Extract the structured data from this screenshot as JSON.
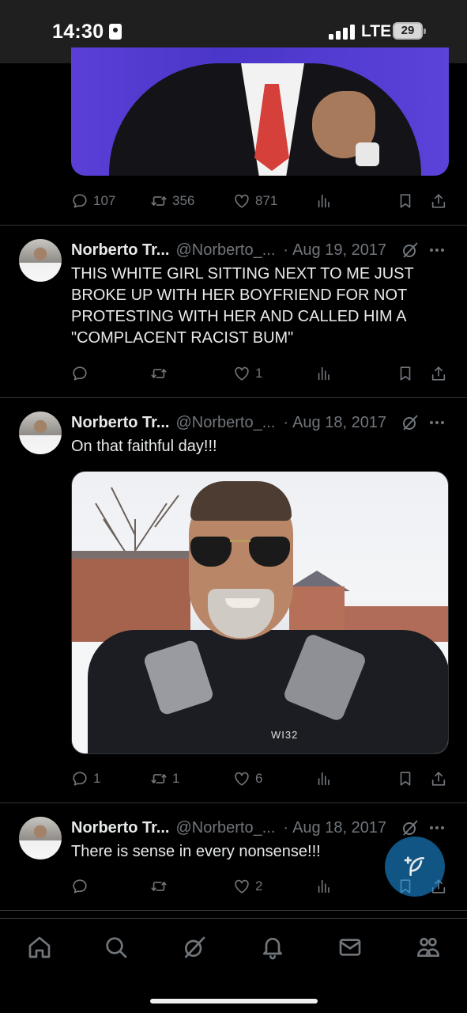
{
  "status_bar": {
    "time": "14:30",
    "network": "LTE",
    "battery": "29"
  },
  "tweets": [
    {
      "counts": {
        "reply": "107",
        "retweet": "356",
        "like": "871"
      }
    },
    {
      "name": "Norberto Tr...",
      "handle": "@Norberto_...",
      "dot": "·",
      "date": "Aug 19, 2017",
      "text": "THIS WHITE GIRL SITTING NEXT TO ME JUST BROKE UP WITH HER BOYFRIEND FOR NOT PROTESTING WITH HER AND CALLED HIM A \"COMPLACENT RACIST BUM\"",
      "counts": {
        "reply": "",
        "retweet": "",
        "like": "1"
      }
    },
    {
      "name": "Norberto Tr...",
      "handle": "@Norberto_...",
      "dot": "·",
      "date": "Aug 18, 2017",
      "text": "On that faithful day!!!",
      "photo_brand": "WI32",
      "counts": {
        "reply": "1",
        "retweet": "1",
        "like": "6"
      }
    },
    {
      "name": "Norberto Tr...",
      "handle": "@Norberto_...",
      "dot": "·",
      "date": "Aug 18, 2017",
      "text": "There is sense in every nonsense!!!",
      "counts": {
        "reply": "",
        "retweet": "",
        "like": "2"
      }
    }
  ],
  "icons": {
    "reply": "reply-icon",
    "retweet": "retweet-icon",
    "like": "heart-icon",
    "views": "views-icon",
    "bookmark": "bookmark-icon",
    "share": "share-icon",
    "grok": "grok-icon",
    "more": "more-icon",
    "compose": "compose-icon"
  },
  "bottom_nav": [
    "home-icon",
    "search-icon",
    "grok-icon",
    "notifications-icon",
    "messages-icon",
    "communities-icon"
  ],
  "colors": {
    "background": "#000000",
    "text": "#e7e9ea",
    "muted": "#71767b",
    "accent": "#1d9bf0"
  }
}
